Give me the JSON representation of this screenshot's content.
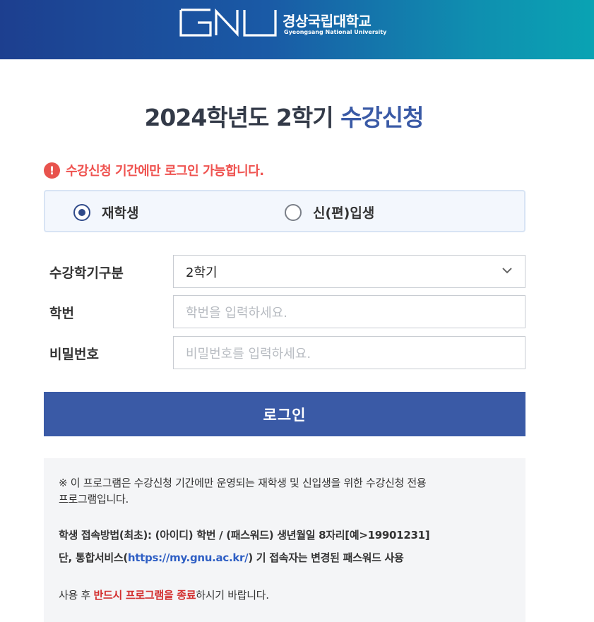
{
  "header": {
    "logo_mark_text": "GNU",
    "university_kr": "경상국립대학교",
    "university_en": "Gyeongsang National University"
  },
  "title": {
    "prefix": "2024학년도 2학기 ",
    "accent": "수강신청"
  },
  "notice": {
    "icon": "!",
    "text": "수강신청 기간에만 로그인 가능합니다."
  },
  "student_type": {
    "options": [
      {
        "label": "재학생",
        "selected": true
      },
      {
        "label": "신(편)입생",
        "selected": false
      }
    ]
  },
  "form": {
    "semester_label": "수강학기구분",
    "semester_value": "2학기",
    "student_id_label": "학번",
    "student_id_placeholder": "학번을 입력하세요.",
    "password_label": "비밀번호",
    "password_placeholder": "비밀번호를 입력하세요."
  },
  "login_button": "로그인",
  "info": {
    "line1": "※ 이 프로그램은 수강신청 기간에만 운영되는 재학생 및 신입생을 위한 수강신청 전용",
    "line2": "프로그램입니다.",
    "line3": "학생 접속방법(최초): (아이디) 학번 / (패스워드) 생년월일 8자리[예>19901231]",
    "line4_prefix": "단, 통합서비스(",
    "line4_link": "https://my.gnu.ac.kr/",
    "line4_suffix": ") 기 접속자는 변경된 패스워드 사용",
    "line5_prefix": "사용 후 ",
    "line5_emphasis": "반드시 프로그램을 종료",
    "line5_suffix": "하시기 바랍니다."
  },
  "colors": {
    "accent": "#3a5aa6",
    "notice": "#ef5350",
    "link": "#2f5fc4",
    "emphasis": "#d32f2f"
  }
}
